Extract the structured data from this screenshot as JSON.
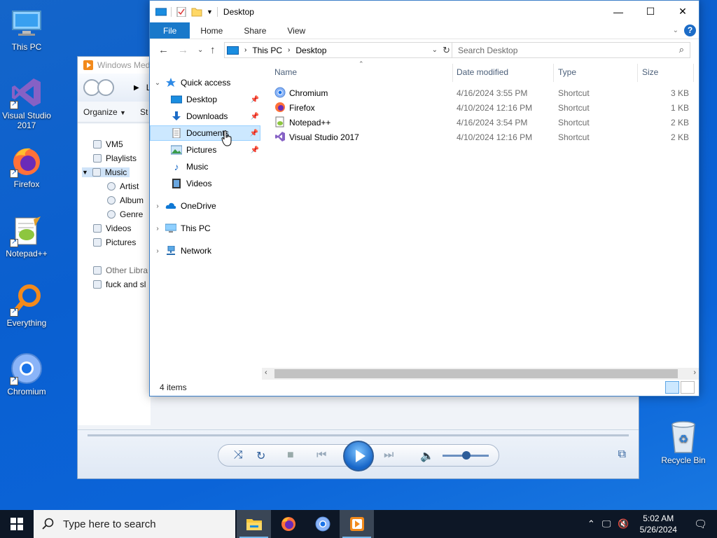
{
  "desktop": {
    "icons": [
      {
        "label": "This PC",
        "icon": "this-pc-icon"
      },
      {
        "label": "Visual Studio 2017",
        "icon": "visual-studio-icon"
      },
      {
        "label": "Firefox",
        "icon": "firefox-icon"
      },
      {
        "label": "Notepad++",
        "icon": "notepadpp-icon"
      },
      {
        "label": "Everything",
        "icon": "everything-search-icon"
      },
      {
        "label": "Chromium",
        "icon": "chromium-icon"
      }
    ],
    "recycle_bin": "Recycle Bin"
  },
  "media_player": {
    "title": "Windows Med",
    "breadcrumb_partial": "L",
    "toolbar": {
      "organize": "Organize",
      "stream_partial": "St"
    },
    "library": [
      {
        "label": "VM5"
      },
      {
        "label": "Playlists"
      },
      {
        "label": "Music"
      },
      {
        "label": "Artist"
      },
      {
        "label": "Album"
      },
      {
        "label": "Genre"
      },
      {
        "label": "Videos"
      },
      {
        "label": "Pictures"
      },
      {
        "label": "Other Libra"
      },
      {
        "label": "fuck and sl"
      }
    ]
  },
  "explorer": {
    "title": "Desktop",
    "ribbon_tabs": [
      "File",
      "Home",
      "Share",
      "View"
    ],
    "address": {
      "root": "This PC",
      "current": "Desktop"
    },
    "search_placeholder": "Search Desktop",
    "nav": {
      "quick_access": "Quick access",
      "pinned": [
        "Desktop",
        "Downloads",
        "Documents",
        "Pictures"
      ],
      "unpinned": [
        "Music",
        "Videos"
      ],
      "onedrive": "OneDrive",
      "this_pc": "This PC",
      "network": "Network"
    },
    "columns": [
      "Name",
      "Date modified",
      "Type",
      "Size"
    ],
    "files": [
      {
        "name": "Chromium",
        "date": "4/16/2024 3:55 PM",
        "type": "Shortcut",
        "size": "3 KB",
        "icon": "chromium-icon"
      },
      {
        "name": "Firefox",
        "date": "4/10/2024 12:16 PM",
        "type": "Shortcut",
        "size": "1 KB",
        "icon": "firefox-icon"
      },
      {
        "name": "Notepad++",
        "date": "4/16/2024 3:54 PM",
        "type": "Shortcut",
        "size": "2 KB",
        "icon": "notepadpp-icon"
      },
      {
        "name": "Visual Studio 2017",
        "date": "4/10/2024 12:16 PM",
        "type": "Shortcut",
        "size": "2 KB",
        "icon": "visual-studio-icon"
      }
    ],
    "status": "4 items"
  },
  "taskbar": {
    "search_placeholder": "Type here to search",
    "time": "5:02 AM",
    "date": "5/26/2024"
  },
  "colors": {
    "accent": "#1979ca",
    "desktop": "#0b64d8",
    "taskbar": "#0d1726",
    "selection": "#cce8ff"
  }
}
